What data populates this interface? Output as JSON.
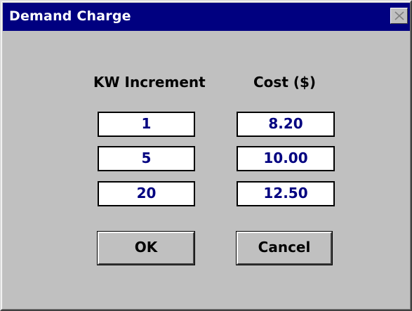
{
  "window": {
    "title": "Demand Charge"
  },
  "columns": {
    "kw_header": "KW Increment",
    "cost_header": "Cost ($)"
  },
  "rows": [
    {
      "kw": "1",
      "cost": "8.20"
    },
    {
      "kw": "5",
      "cost": "10.00"
    },
    {
      "kw": "20",
      "cost": "12.50"
    }
  ],
  "buttons": {
    "ok_label": "OK",
    "cancel_label": "Cancel"
  },
  "icons": {
    "close": "close-icon"
  },
  "colors": {
    "titlebar": "#000080",
    "field_text": "#000080",
    "dialog_bg": "#c0c0c0"
  }
}
